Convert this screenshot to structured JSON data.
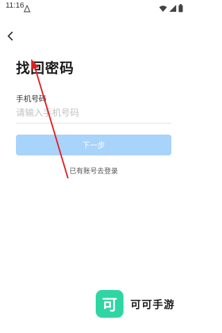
{
  "status_bar": {
    "time": "11:16",
    "icons": [
      "notification-icon",
      "wifi-icon",
      "signal-icon",
      "battery-icon"
    ]
  },
  "page": {
    "title": "找回密码",
    "back_icon": "chevron-left-icon"
  },
  "form": {
    "phone_label": "手机号码",
    "phone_value": "",
    "phone_placeholder": "请输入手机号码",
    "next_button": "下一步",
    "login_link": "已有账号去登录"
  },
  "brand": {
    "logo_text": "可",
    "name": "可可手游"
  },
  "colors": {
    "button_disabled": "#a8d3fb",
    "brand_green": "#2fd6a4",
    "annotation_red": "#e02020"
  }
}
